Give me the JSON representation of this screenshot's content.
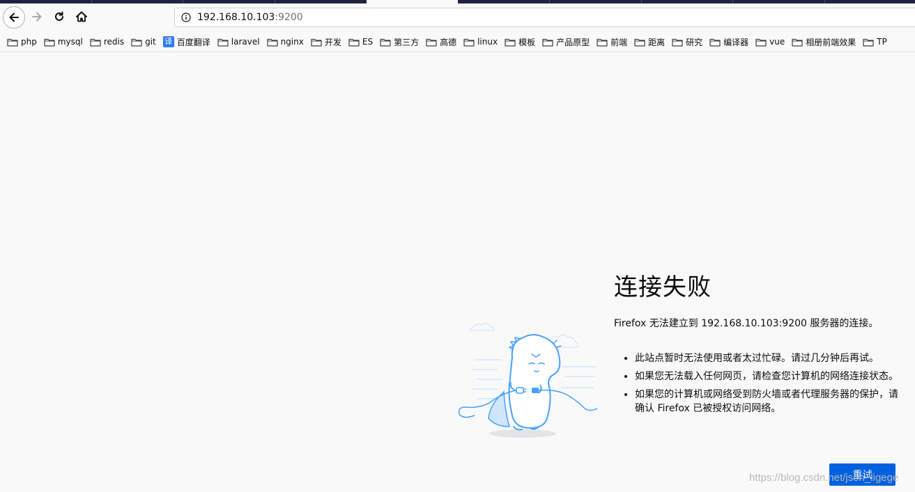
{
  "browser": {
    "url_host": "192.168.10.103",
    "url_port": ":9200"
  },
  "bookmarks": [
    {
      "label": "php",
      "icon": "folder-icon"
    },
    {
      "label": "mysql",
      "icon": "folder-icon"
    },
    {
      "label": "redis",
      "icon": "folder-icon"
    },
    {
      "label": "git",
      "icon": "folder-icon"
    },
    {
      "label": "百度翻译",
      "icon": "translate-icon",
      "icon_glyph": "译"
    },
    {
      "label": "laravel",
      "icon": "folder-icon"
    },
    {
      "label": "nginx",
      "icon": "folder-icon"
    },
    {
      "label": "开发",
      "icon": "folder-icon"
    },
    {
      "label": "ES",
      "icon": "folder-icon"
    },
    {
      "label": "第三方",
      "icon": "folder-icon"
    },
    {
      "label": "高德",
      "icon": "folder-icon"
    },
    {
      "label": "linux",
      "icon": "folder-icon"
    },
    {
      "label": "模板",
      "icon": "folder-icon"
    },
    {
      "label": "产品原型",
      "icon": "folder-icon"
    },
    {
      "label": "前端",
      "icon": "folder-icon"
    },
    {
      "label": "距离",
      "icon": "folder-icon"
    },
    {
      "label": "研究",
      "icon": "folder-icon"
    },
    {
      "label": "编译器",
      "icon": "folder-icon"
    },
    {
      "label": "vue",
      "icon": "folder-icon"
    },
    {
      "label": "相册前端效果",
      "icon": "folder-icon"
    },
    {
      "label": "TP",
      "icon": "folder-icon"
    }
  ],
  "error_page": {
    "title": "连接失败",
    "description": "Firefox 无法建立到 192.168.10.103:9200 服务器的连接。",
    "bullets": [
      "此站点暂时无法使用或者太过忙碌。请过几分钟后再试。",
      "如果您无法载入任何网页，请检查您计算机的网络连接状态。",
      "如果您的计算机或网络受到防火墙或者代理服务器的保护，请确认 Firefox 已被授权访问网络。"
    ],
    "retry_label": "重试"
  },
  "watermark": "https://blog.csdn.net/json_ligege",
  "colors": {
    "tab_strip": "#202340",
    "page_bg": "#f9f9fa",
    "primary_button": "#0060df",
    "illustration": "#45a1ff"
  }
}
